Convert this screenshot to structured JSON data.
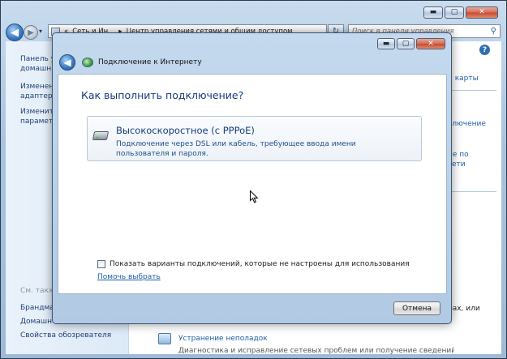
{
  "outer_window": {
    "caption": {
      "minimize": "▬",
      "maximize": "▢",
      "close": "✕"
    },
    "nav": {
      "back_glyph": "◀",
      "forward_glyph": "▶",
      "recent_glyph": "▾",
      "breadcrumb": [
        "«",
        "Сеть и Ин...",
        "▸",
        "Центр управления сетями и общим доступом"
      ],
      "address_dropdown": "▾",
      "refresh_glyph": "↻",
      "search_placeholder": "Поиск в панели управления",
      "search_glyph": "⚲"
    },
    "left_pane": {
      "items": [
        "Панель у",
        "домашн",
        "Изменен",
        "адаптер",
        "Изменит",
        "параметр"
      ],
      "see_also_heading": "См. такж",
      "see_also": [
        "Брандма",
        "Домашн",
        "Свойства обозревателя"
      ]
    },
    "help_glyph": "?",
    "right_pane": {
      "items": [
        "и карты",
        "ключение",
        "ие по",
        "сети"
      ],
      "bottom_text": "рах, или"
    },
    "troubleshoot": {
      "link": "Устранение неполадок",
      "desc": "Диагностика и исправление сетевых проблем или получение сведений об"
    }
  },
  "dialog": {
    "title": "Подключение к Интернету",
    "back_glyph": "◀",
    "caption": {
      "minimize": "▬",
      "maximize": "▢",
      "close": "✕"
    },
    "heading": "Как выполнить подключение?",
    "option": {
      "title": "Высокоскоростное (с PPPoE)",
      "description": "Подключение через DSL или кабель, требующее ввода имени пользователя и пароля."
    },
    "checkbox_label": "Показать варианты подключений, которые не настроены для использования",
    "help_link": "Помочь выбрать",
    "cancel_label": "Отмена"
  },
  "colors": {
    "link": "#1d5ea8",
    "heading": "#123d7a",
    "frame": "#b1c9e3"
  }
}
